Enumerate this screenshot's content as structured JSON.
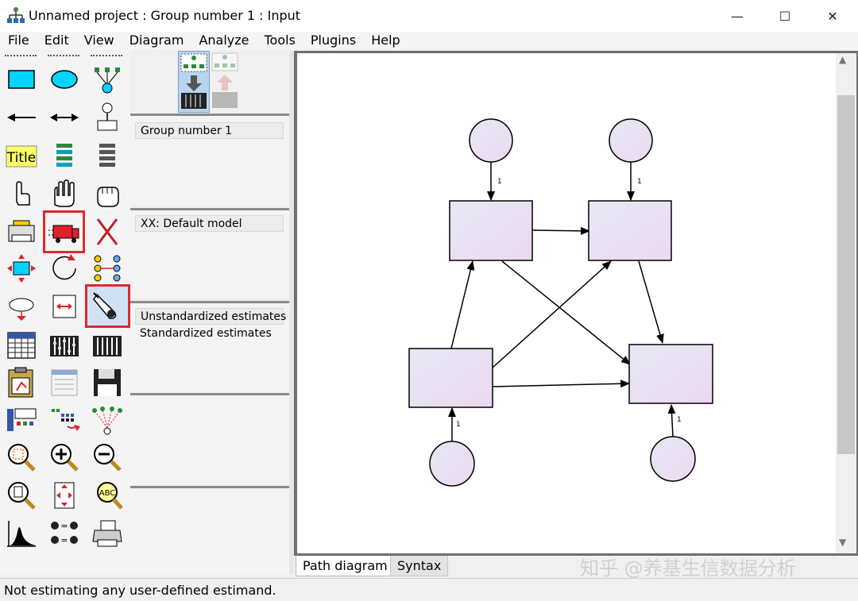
{
  "window": {
    "title": "Unnamed project : Group number 1 : Input",
    "controls": {
      "minimize": "—",
      "maximize": "☐",
      "close": "✕"
    }
  },
  "menu": [
    "File",
    "Edit",
    "View",
    "Diagram",
    "Analyze",
    "Tools",
    "Plugins",
    "Help"
  ],
  "toolbox": {
    "title_tool_label": "Title",
    "highlighted_tools": [
      "copy-truck-tool",
      "bayesian-tool"
    ]
  },
  "panels": {
    "groups": [
      "Group number 1"
    ],
    "models": [
      "XX: Default model"
    ],
    "estimates": [
      "Unstandardized estimates",
      "Standardized estimates"
    ]
  },
  "diagram": {
    "path_label": "1",
    "colors": {
      "node_fill_start": "#e6e8f4",
      "node_fill_end": "#ecd8f0",
      "stroke": "#000000"
    }
  },
  "tabs": [
    "Path diagram",
    "Syntax"
  ],
  "watermark": "知乎 @养基生信数据分析",
  "status": "Not estimating any user-defined estimand."
}
